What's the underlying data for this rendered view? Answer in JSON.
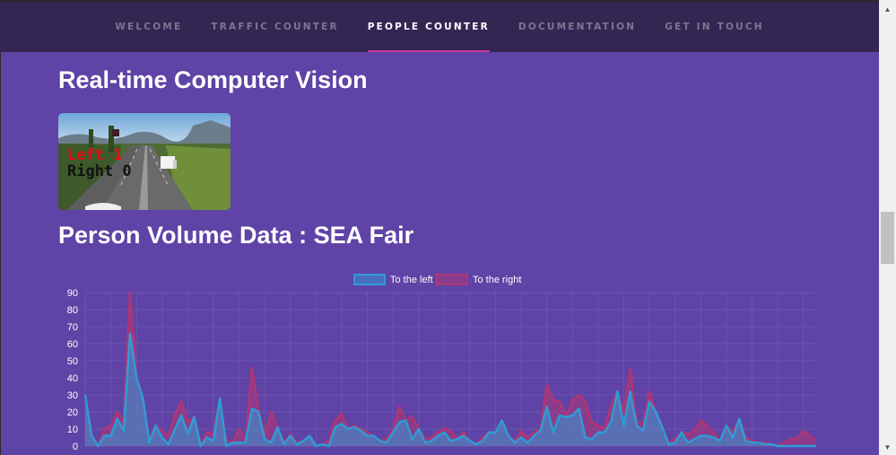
{
  "nav": {
    "items": [
      {
        "label": "WELCOME",
        "active": false
      },
      {
        "label": "TRAFFIC COUNTER",
        "active": false
      },
      {
        "label": "PEOPLE COUNTER",
        "active": true
      },
      {
        "label": "DOCUMENTATION",
        "active": false
      },
      {
        "label": "GET IN TOUCH",
        "active": false
      }
    ],
    "accent_color": "#c4379c"
  },
  "main": {
    "heading_cv": "Real-time Computer Vision",
    "video_overlay": {
      "left_text": "Left 1",
      "right_text": "Right 0"
    },
    "heading_data": "Person Volume Data : SEA Fair"
  },
  "chart_data": {
    "type": "area",
    "legend": {
      "placement": "top",
      "entries": [
        "To the left",
        "To the right"
      ]
    },
    "yticks": [
      "90",
      "80",
      "70",
      "60",
      "50",
      "40",
      "30",
      "20",
      "10",
      "0"
    ],
    "ylim": [
      0,
      90
    ],
    "grid": true,
    "series": [
      {
        "name": "To the left",
        "color": "#2f9bd6",
        "values": [
          30,
          6,
          0,
          6,
          6,
          16,
          9,
          66,
          40,
          28,
          2,
          12,
          5,
          1,
          10,
          18,
          7,
          17,
          0,
          5,
          3,
          28,
          0,
          2,
          2,
          2,
          22,
          20,
          4,
          2,
          11,
          1,
          6,
          1,
          3,
          6,
          0,
          1,
          0,
          11,
          13,
          10,
          11,
          9,
          6,
          6,
          3,
          2,
          8,
          14,
          15,
          4,
          10,
          2,
          3,
          6,
          8,
          3,
          4,
          6,
          3,
          1,
          3,
          8,
          8,
          15,
          6,
          2,
          5,
          2,
          6,
          9,
          23,
          8,
          18,
          17,
          18,
          22,
          5,
          4,
          8,
          8,
          14,
          32,
          12,
          32,
          12,
          9,
          26,
          20,
          11,
          1,
          2,
          8,
          2,
          4,
          6,
          6,
          5,
          3,
          12,
          5,
          16,
          3,
          2,
          2,
          1,
          1,
          0,
          0,
          0,
          0,
          0,
          0,
          0
        ]
      },
      {
        "name": "To the right",
        "color": "#b03574",
        "values": [
          30,
          6,
          0,
          10,
          12,
          20,
          15,
          90,
          40,
          28,
          4,
          12,
          9,
          6,
          18,
          26,
          14,
          17,
          1,
          8,
          7,
          28,
          3,
          2,
          10,
          3,
          46,
          22,
          6,
          20,
          11,
          2,
          7,
          2,
          3,
          6,
          0,
          1,
          3,
          15,
          19,
          10,
          12,
          10,
          8,
          6,
          3,
          4,
          10,
          23,
          15,
          17,
          10,
          4,
          5,
          8,
          10,
          9,
          4,
          8,
          3,
          1,
          5,
          8,
          8,
          15,
          6,
          3,
          9,
          5,
          8,
          10,
          36,
          27,
          26,
          17,
          27,
          30,
          26,
          14,
          12,
          10,
          24,
          32,
          20,
          45,
          14,
          13,
          32,
          20,
          11,
          2,
          4,
          8,
          7,
          9,
          15,
          12,
          8,
          3,
          12,
          8,
          16,
          5,
          3,
          2,
          2,
          1,
          0,
          2,
          4,
          4,
          9,
          6,
          3
        ]
      }
    ],
    "colors": {
      "grid": "#6b55ad",
      "tick": "#ffffff"
    }
  }
}
